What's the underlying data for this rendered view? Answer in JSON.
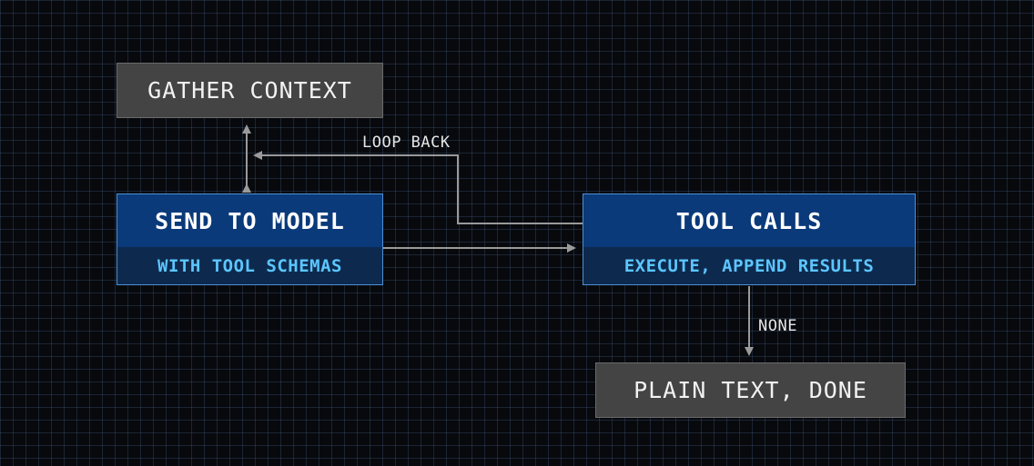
{
  "nodes": {
    "gather_context": {
      "label": "GATHER CONTEXT"
    },
    "send_to_model": {
      "title": "SEND TO MODEL",
      "subtitle": "WITH TOOL SCHEMAS"
    },
    "tool_calls": {
      "title": "TOOL CALLS",
      "subtitle": "EXECUTE, APPEND RESULTS"
    },
    "plain_text_done": {
      "label": "PLAIN TEXT, DONE"
    }
  },
  "edges": {
    "loop_back": {
      "label": "LOOP BACK"
    },
    "none": {
      "label": "NONE"
    }
  },
  "colors": {
    "background": "#07090d",
    "grid": "#465f82",
    "gray_node": "#444444",
    "blue_header": "#0a3a7a",
    "blue_sub": "#0d2a4e",
    "blue_border": "#4f8fd6",
    "sub_text": "#5cc6ff",
    "arrow": "#9a9a9a"
  }
}
